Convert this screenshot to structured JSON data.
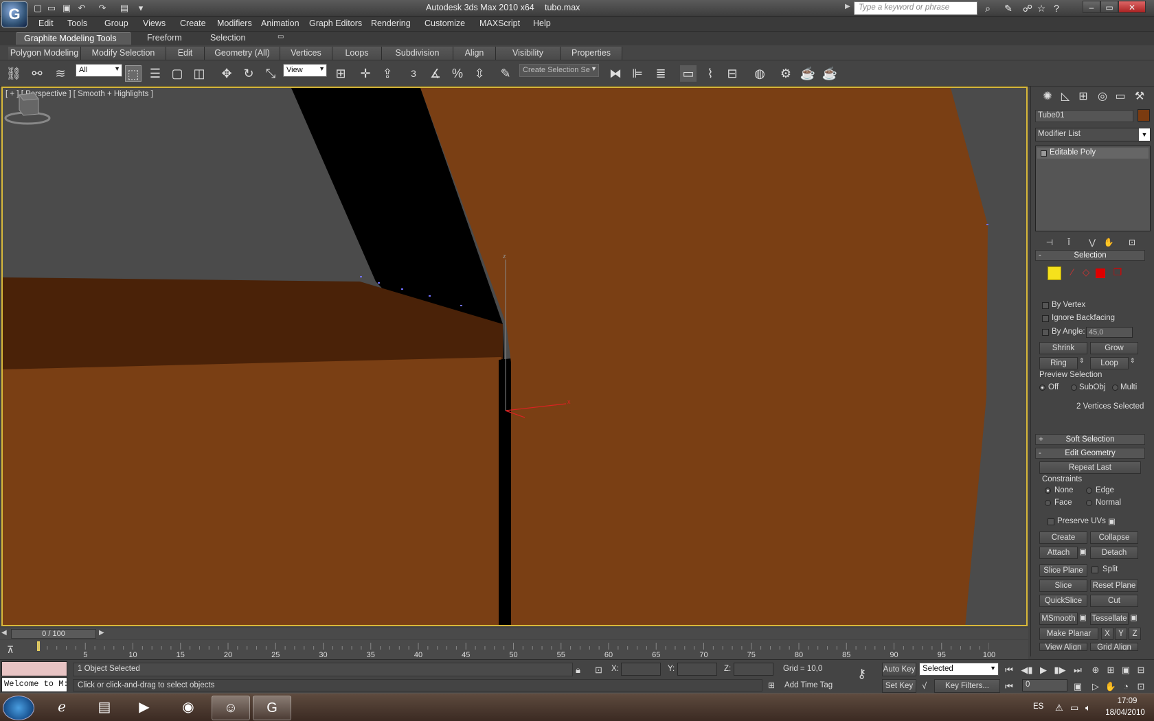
{
  "window": {
    "title": "Autodesk 3ds Max  2010 x64",
    "file": "tubo.max",
    "search_placeholder": "Type a keyword or phrase"
  },
  "menu": [
    "Edit",
    "Tools",
    "Group",
    "Views",
    "Create",
    "Modifiers",
    "Animation",
    "Graph Editors",
    "Rendering",
    "Customize",
    "MAXScript",
    "Help"
  ],
  "ribbon": {
    "tabs": [
      "Graphite Modeling Tools",
      "Freeform",
      "Selection"
    ],
    "sub": [
      "Polygon Modeling",
      "Modify Selection",
      "Edit",
      "Geometry (All)",
      "Vertices",
      "Loops",
      "Subdivision",
      "Align",
      "Visibility",
      "Properties"
    ]
  },
  "toolbar": {
    "filter": "All",
    "ref_coord": "View",
    "named_sel_placeholder": "Create Selection Se",
    "snap_label": "3"
  },
  "viewport": {
    "label": "[ + ] [ Perspective ] [ Smooth + Highlights ]",
    "colors": {
      "orange": "#7a3f14",
      "dark_orange": "#4a2208",
      "black": "#000000",
      "grey": "#4b4b4b",
      "active_border": "#d9b93a"
    }
  },
  "command_panel": {
    "object_name": "Tube01",
    "object_color": "#7a3b10",
    "modifier_list": "Modifier List",
    "stack_item": "Editable Poly",
    "selection": {
      "title": "Selection",
      "by_vertex": "By Vertex",
      "ignore_backfacing": "Ignore Backfacing",
      "by_angle": "By Angle:",
      "angle_value": "45,0",
      "shrink": "Shrink",
      "grow": "Grow",
      "ring": "Ring",
      "loop": "Loop",
      "preview_selection": "Preview Selection",
      "preview_off": "Off",
      "preview_subobj": "SubObj",
      "preview_multi": "Multi",
      "status": "2 Vertices Selected"
    },
    "soft_selection": "Soft Selection",
    "edit_geometry": {
      "title": "Edit Geometry",
      "repeat_last": "Repeat Last",
      "constraints": "Constraints",
      "none": "None",
      "edge": "Edge",
      "face": "Face",
      "normal": "Normal",
      "preserve_uvs": "Preserve UVs",
      "create": "Create",
      "collapse": "Collapse",
      "attach": "Attach",
      "detach": "Detach",
      "slice_plane": "Slice Plane",
      "split": "Split",
      "slice": "Slice",
      "reset_plane": "Reset Plane",
      "quickslice": "QuickSlice",
      "cut": "Cut",
      "msmooth": "MSmooth",
      "tessellate": "Tessellate",
      "make_planar": "Make Planar",
      "x": "X",
      "y": "Y",
      "z": "Z",
      "view_align": "View Align",
      "grid_align": "Grid Align"
    }
  },
  "timeline": {
    "slider": "0 / 100",
    "ticks": [
      "5",
      "10",
      "15",
      "20",
      "25",
      "30",
      "35",
      "40",
      "45",
      "50",
      "55",
      "60",
      "65",
      "70",
      "75",
      "80",
      "85",
      "90",
      "95",
      "100"
    ]
  },
  "status": {
    "listener": "Welcome to M:",
    "selected": "1 Object Selected",
    "prompt": "Click or click-and-drag to select objects",
    "x_label": "X:",
    "y_label": "Y:",
    "z_label": "Z:",
    "grid": "Grid = 10,0",
    "add_time_tag": "Add Time Tag",
    "auto_key": "Auto Key",
    "set_key": "Set Key",
    "selected_dropdown": "Selected",
    "key_filters": "Key Filters...",
    "frame": "0"
  },
  "taskbar": {
    "lang": "ES",
    "time": "17:09",
    "date": "18/04/2010"
  }
}
